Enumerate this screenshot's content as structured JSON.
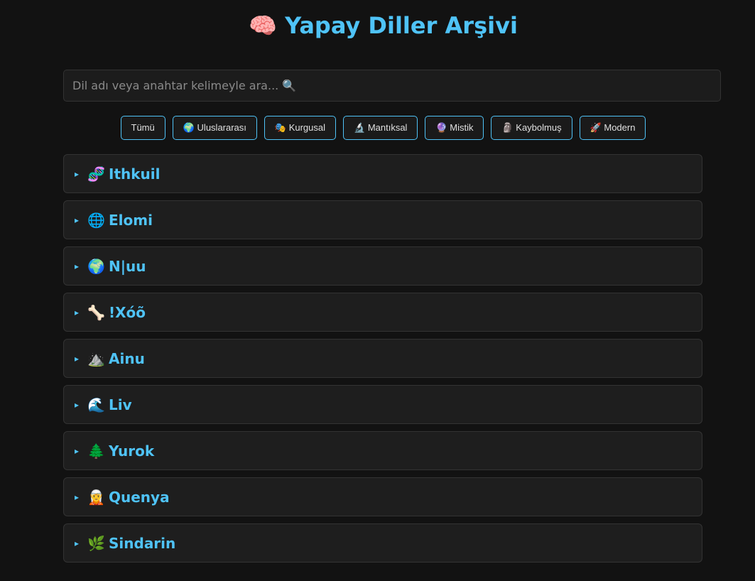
{
  "header": {
    "icon": "🧠",
    "title": "Yapay Diller Arşivi"
  },
  "search": {
    "placeholder": "Dil adı veya anahtar kelimeyle ara... 🔍",
    "value": ""
  },
  "filters": [
    {
      "id": "all",
      "label": "Tümü"
    },
    {
      "id": "international",
      "label": "🌍 Uluslararası"
    },
    {
      "id": "fictional",
      "label": "🎭 Kurgusal"
    },
    {
      "id": "logical",
      "label": "🔬 Mantıksal"
    },
    {
      "id": "mystic",
      "label": "🔮 Mistik"
    },
    {
      "id": "lost",
      "label": "🗿 Kaybolmuş"
    },
    {
      "id": "modern",
      "label": "🚀 Modern"
    }
  ],
  "languages": [
    {
      "icon": "🧬",
      "name": "Ithkuil"
    },
    {
      "icon": "🌐",
      "name": "Elomi"
    },
    {
      "icon": "🌍",
      "name": "N|uu"
    },
    {
      "icon": "🦴",
      "name": "!Xóõ"
    },
    {
      "icon": "⛰️",
      "name": "Ainu"
    },
    {
      "icon": "🌊",
      "name": "Liv"
    },
    {
      "icon": "🌲",
      "name": "Yurok"
    },
    {
      "icon": "🧝",
      "name": "Quenya"
    },
    {
      "icon": "🌿",
      "name": "Sindarin"
    }
  ],
  "expand_indicator": "▸",
  "colors": {
    "accent": "#4fc3f7",
    "background": "#121212",
    "card": "#1e1e1e"
  }
}
